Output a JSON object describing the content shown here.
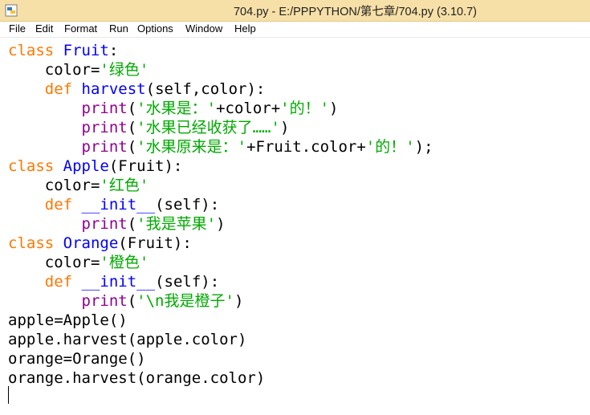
{
  "window": {
    "title": "704.py - E:/PPPYTHON/第七章/704.py (3.10.7)"
  },
  "menu": {
    "file": "File",
    "edit": "Edit",
    "format": "Format",
    "run": "Run",
    "options": "Options",
    "window": "Window",
    "help": "Help"
  },
  "code": {
    "l1": {
      "kw": "class",
      "name": "Fruit",
      "rest": ":"
    },
    "l2": {
      "indent": "    ",
      "pre": "color=",
      "str": "'绿色'"
    },
    "l3": {
      "indent": "    ",
      "kw": "def",
      "name": "harvest",
      "rest": "(self,color):"
    },
    "l4": {
      "indent": "        ",
      "bi": "print",
      "p1": "(",
      "s1": "'水果是：'",
      "mid": "+color+",
      "s2": "'的！'",
      "end": ")"
    },
    "l5": {
      "indent": "        ",
      "bi": "print",
      "p1": "(",
      "s1": "'水果已经收获了……'",
      "end": ")"
    },
    "l6": {
      "indent": "        ",
      "bi": "print",
      "p1": "(",
      "s1": "'水果原来是：'",
      "mid": "+Fruit.color+",
      "s2": "'的！'",
      "end": ");"
    },
    "l7": {
      "kw": "class",
      "name": "Apple",
      "rest": "(Fruit):"
    },
    "l8": {
      "indent": "    ",
      "pre": "color=",
      "str": "'红色'"
    },
    "l9": {
      "indent": "    ",
      "kw": "def",
      "name": "__init__",
      "rest": "(self):"
    },
    "l10": {
      "indent": "        ",
      "bi": "print",
      "p1": "(",
      "s1": "'我是苹果'",
      "end": ")"
    },
    "l11": {
      "kw": "class",
      "name": "Orange",
      "rest": "(Fruit):"
    },
    "l12": {
      "indent": "    ",
      "pre": "color=",
      "str": "'橙色'"
    },
    "l13": {
      "indent": "    ",
      "kw": "def",
      "name": "__init__",
      "rest": "(self):"
    },
    "l14": {
      "indent": "        ",
      "bi": "print",
      "p1": "(",
      "s1": "'\\n我是橙子'",
      "end": ")"
    },
    "l15": "apple=Apple()",
    "l16": "apple.harvest(apple.color)",
    "l17": "orange=Orange()",
    "l18": "orange.harvest(orange.color)"
  },
  "colors": {
    "keyword": "#ff7700",
    "definition": "#0000ff",
    "string": "#00aa00",
    "builtin": "#900090",
    "titlebar": "#f7e0a8"
  }
}
